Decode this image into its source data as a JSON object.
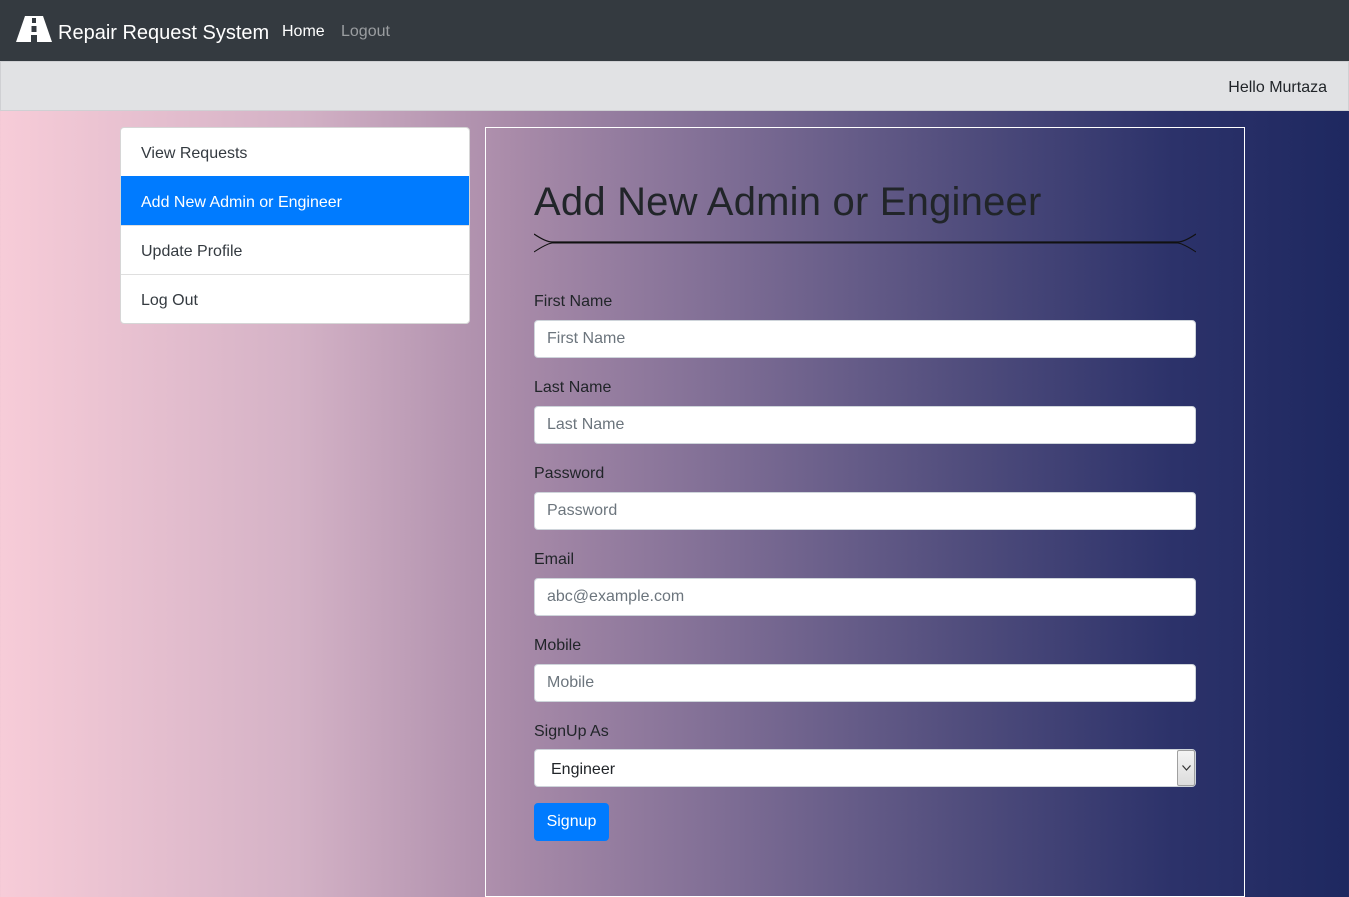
{
  "navbar": {
    "brand_icon": "road-icon",
    "brand": "Repair Request System",
    "links": [
      {
        "label": "Home"
      },
      {
        "label": "Logout"
      }
    ]
  },
  "greeting": "Hello Murtaza",
  "sidebar": {
    "items": [
      {
        "label": "View Requests",
        "active": false
      },
      {
        "label": "Add New Admin or Engineer",
        "active": true
      },
      {
        "label": "Update Profile",
        "active": false
      },
      {
        "label": "Log Out",
        "active": false
      }
    ]
  },
  "form": {
    "title": "Add New Admin or Engineer",
    "fields": [
      {
        "label": "First Name",
        "placeholder": "First Name",
        "value": ""
      },
      {
        "label": "Last Name",
        "placeholder": "Last Name",
        "value": ""
      },
      {
        "label": "Password",
        "placeholder": "Password",
        "value": ""
      },
      {
        "label": "Email",
        "placeholder": "abc@example.com",
        "value": ""
      },
      {
        "label": "Mobile",
        "placeholder": "Mobile",
        "value": ""
      }
    ],
    "role": {
      "label": "SignUp As",
      "selected": "Engineer"
    },
    "submit_label": "Signup"
  },
  "colors": {
    "navbar_bg": "#343a40",
    "accent": "#007bff",
    "greetbar_bg": "#e1e2e4"
  }
}
